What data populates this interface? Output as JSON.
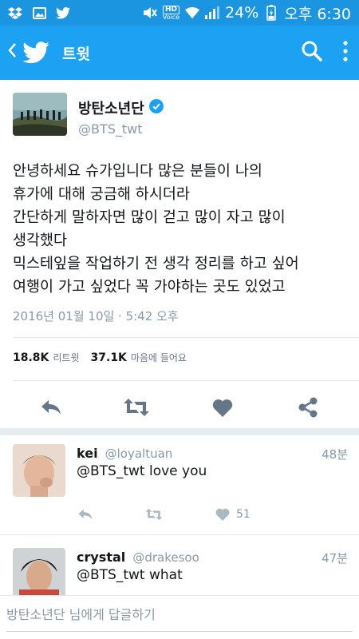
{
  "status_bar": {
    "hd_label": "HD",
    "voice_label": "Voice",
    "battery": "24%",
    "time": "오후 6:30"
  },
  "app_bar": {
    "title": "트윗",
    "accent": "#1da1f2"
  },
  "tweet": {
    "display_name": "방탄소년단",
    "handle": "@BTS_twt",
    "lines": [
      "안녕하세요 슈가입니다 많은 분들이 나의",
      "휴가에 대해 궁금해 하시더라",
      "간단하게 말하자면 많이 걷고 많이 자고 많이",
      "생각했다",
      "믹스테잎을 작업하기 전 생각 정리를 하고 싶어",
      "여행이 가고 싶었다 꼭 가야하는 곳도 있었고"
    ],
    "timestamp": "2016년 01월 10일 · 5:42 오후",
    "retweet_count": "18.8K",
    "retweet_label": "리트윗",
    "like_count": "37.1K",
    "like_label": "마음에 들어요"
  },
  "replies": [
    {
      "name": "kei",
      "handle": "@loyaltuan",
      "time": "48분",
      "text": "@BTS_twt love you",
      "like_count": "51"
    },
    {
      "name": "crystal",
      "handle": "@drakesoo",
      "time": "47분",
      "text": "@BTS_twt what"
    }
  ],
  "compose": {
    "placeholder": "방탄소년단 님에게 답글하기"
  },
  "icons": {
    "status_left": [
      "dropbox-icon",
      "image-icon",
      "twitter-icon"
    ],
    "status_right": [
      "mute-icon",
      "wifi-icon",
      "signal-icon",
      "battery-icon"
    ],
    "app_bar": [
      "back-icon",
      "twitter-bird-icon",
      "search-icon",
      "more-icon"
    ],
    "tweet_actions": [
      "reply-icon",
      "retweet-icon",
      "like-icon",
      "share-icon"
    ]
  }
}
